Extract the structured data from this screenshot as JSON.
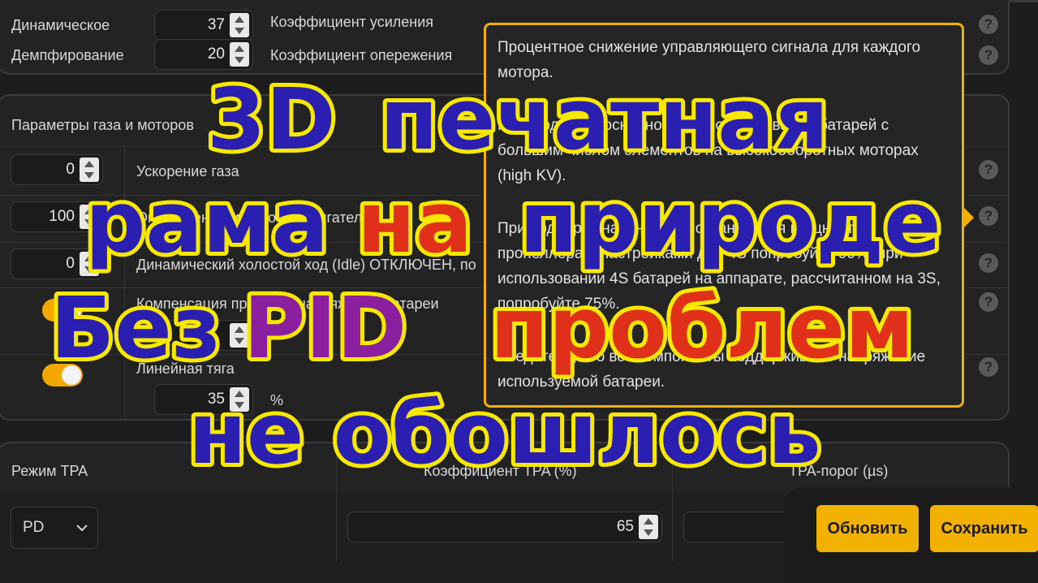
{
  "pid_panel": {
    "rows": [
      {
        "left_label": "Динамическое",
        "value": "37",
        "right_label": "Коэффициент усиления"
      },
      {
        "left_label": "Демпфирование",
        "value": "20",
        "right_label": "Коэффициент опережения"
      }
    ]
  },
  "throttle_panel": {
    "title": "Параметры газа и моторов",
    "rows": [
      {
        "value": "0",
        "label": "Ускорение газа"
      },
      {
        "value": "100",
        "label": "Ограничение мощности двигателей"
      },
      {
        "value": "0",
        "label": "Динамический холостой ход (Idle) ОТКЛЮЧЕН, по"
      }
    ],
    "toggle_rows": [
      {
        "label": "Компенсация просадки напряжения батареи",
        "on": true
      },
      {
        "label": "Линейная тяга",
        "value": "35",
        "unit": "%",
        "on": true
      }
    ]
  },
  "tooltip": {
    "paragraphs": [
      "Процентное снижение управляющего сигнала для каждого мотора.",
      "Необходимо в основном при использовании батарей с большим числом элементов на высокооборотных моторах (high KV).",
      "При подборе значения для ограничения мощности пропеллера и настройками для 4S попробуйте 66%, при использовании 4S батарей на аппарате, рассчитанном на 3S, попробуйте 75%.",
      "Убедитесь, что все компоненты поддерживают напряжение используемой батареи."
    ]
  },
  "tpa_panel": {
    "mode_label": "Режим TPA",
    "rate_label": "Коэффициент TPA (%)",
    "breakpoint_label": "TPA-порог (µs)",
    "mode_value": "PD",
    "rate_value": "65",
    "breakpoint_value": ""
  },
  "buttons": {
    "refresh": "Обновить",
    "save": "Сохранить"
  },
  "help_glyph": "?",
  "overlay_text": {
    "line1a": "3D",
    "line1b": "печатная",
    "line2a": "рама",
    "line2b": "на",
    "line2c": "природе",
    "line3a": "Без",
    "line3b": "PID",
    "line3c": "проблем",
    "line4": "не обошлось"
  },
  "colors": {
    "accent": "#f2b000",
    "overlay_fill": "#2a1fb0",
    "overlay_outline": "#f6e800",
    "overlay_red": "#e0301a"
  }
}
